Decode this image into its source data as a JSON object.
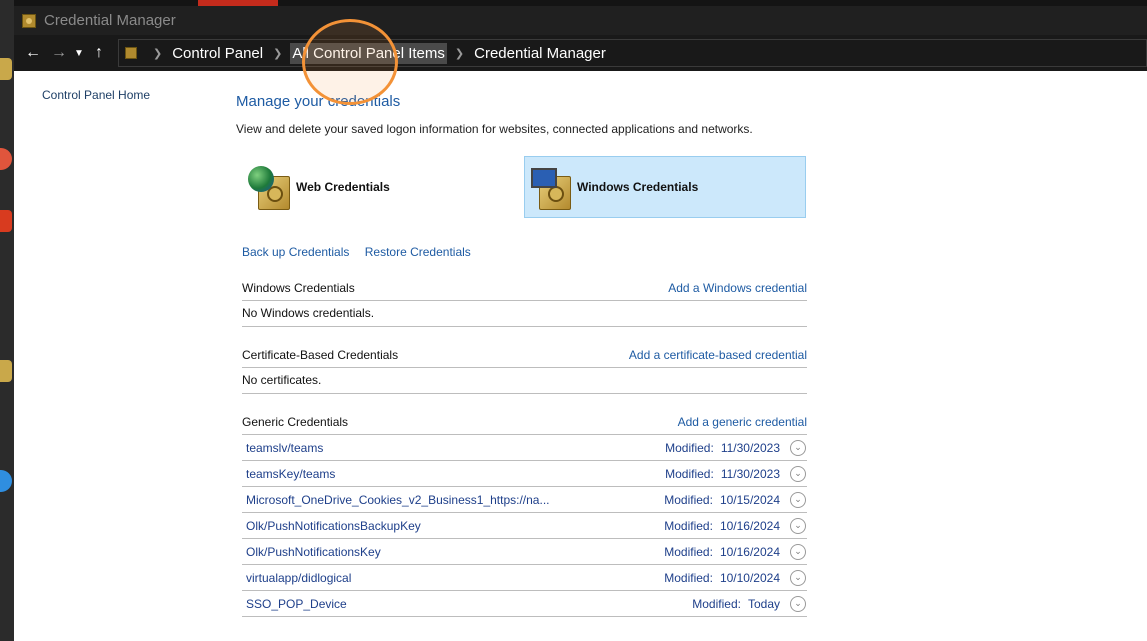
{
  "window": {
    "title": "Credential Manager"
  },
  "address_bar": {
    "crumbs": [
      "Control Panel",
      "All Control Panel Items",
      "Credential Manager"
    ]
  },
  "left_nav": {
    "home_link": "Control Panel Home"
  },
  "main": {
    "heading": "Manage your credentials",
    "description": "View and delete your saved logon information for websites, connected applications and networks.",
    "tiles": {
      "web": "Web Credentials",
      "windows": "Windows Credentials"
    },
    "backup_link": "Back up Credentials",
    "restore_link": "Restore Credentials"
  },
  "sections": {
    "windows": {
      "title": "Windows Credentials",
      "add": "Add a Windows credential",
      "empty": "No Windows credentials."
    },
    "certificate": {
      "title": "Certificate-Based Credentials",
      "add": "Add a certificate-based credential",
      "empty": "No certificates."
    },
    "generic": {
      "title": "Generic Credentials",
      "add": "Add a generic credential",
      "modified_label": "Modified:",
      "items": [
        {
          "name": "teamslv/teams",
          "date": "11/30/2023"
        },
        {
          "name": "teamsKey/teams",
          "date": "11/30/2023"
        },
        {
          "name": "Microsoft_OneDrive_Cookies_v2_Business1_https://na...",
          "date": "10/15/2024"
        },
        {
          "name": "Olk/PushNotificationsBackupKey",
          "date": "10/16/2024"
        },
        {
          "name": "Olk/PushNotificationsKey",
          "date": "10/16/2024"
        },
        {
          "name": "virtualapp/didlogical",
          "date": "10/10/2024"
        },
        {
          "name": "SSO_POP_Device",
          "date": "Today"
        }
      ]
    }
  },
  "colors": {
    "accent": "#1e5ba3",
    "selected_tile": "#cce8fb",
    "highlight_ring": "#f39237"
  }
}
